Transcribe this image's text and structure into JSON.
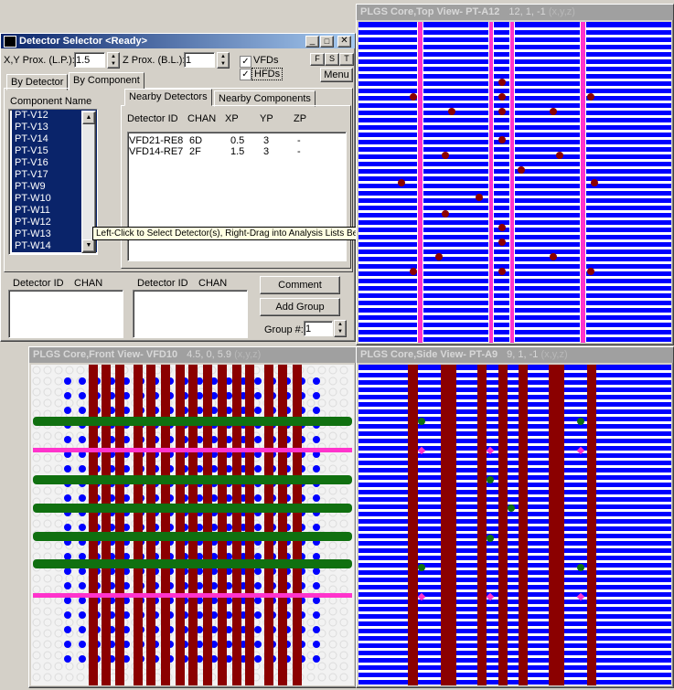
{
  "selector": {
    "title": "Detector Selector <Ready>",
    "xy_prox_label": "X,Y Prox. (L.P.):",
    "xy_prox_value": "1.5",
    "z_prox_label": "Z Prox. (B.L.):",
    "z_prox_value": "1",
    "vfds_label": "VFDs",
    "hfds_label": "HFDs",
    "vfds_checked": true,
    "hfds_checked": true,
    "btn_f": "F",
    "btn_s": "S",
    "btn_t": "T",
    "menu_label": "Menu",
    "tab_by_detector": "By Detector",
    "tab_by_component": "By Component",
    "component_header": "Component Name",
    "components": [
      "PT-V12",
      "PT-V13",
      "PT-V14",
      "PT-V15",
      "PT-V16",
      "PT-V17",
      "PT-W9",
      "PT-W10",
      "PT-W11",
      "PT-W12",
      "PT-W13",
      "PT-W14"
    ],
    "subtab_nearby_detectors": "Nearby Detectors",
    "subtab_nearby_components": "Nearby Components",
    "columns": [
      "Detector ID",
      "CHAN",
      "XP",
      "YP",
      "ZP"
    ],
    "rows": [
      {
        "id": "VFD21-RE8",
        "chan": "6D",
        "xp": "0.5",
        "yp": "3",
        "zp": "-"
      },
      {
        "id": "VFD14-RE7",
        "chan": "2F",
        "xp": "1.5",
        "yp": "3",
        "zp": "-"
      }
    ],
    "tooltip": "Left-Click to Select Detector(s), Right-Drag into Analysis Lists Below",
    "lower_col1": "Detector ID",
    "lower_col2": "CHAN",
    "lower_col3": "Detector ID",
    "lower_col4": "CHAN",
    "comment_label": "Comment",
    "add_group_label": "Add Group",
    "group_label": "Group #:",
    "group_value": "1"
  },
  "top_view": {
    "title": "PLGS Core,Top View- PT-A12",
    "coords": "12, 1, -1",
    "xyz": "(x,y,z)"
  },
  "front_view": {
    "title": "PLGS Core,Front View- VFD10",
    "coords": "4.5, 0, 5.9",
    "xyz": "(x,y,z)"
  },
  "side_view": {
    "title": "PLGS Core,Side View- PT-A9",
    "coords": "9, 1, -1",
    "xyz": "(x,y,z)"
  },
  "colors": {
    "blue": "#0000ff",
    "dark_red": "#8b0000",
    "magenta": "#ff33cc",
    "green": "#107010"
  }
}
